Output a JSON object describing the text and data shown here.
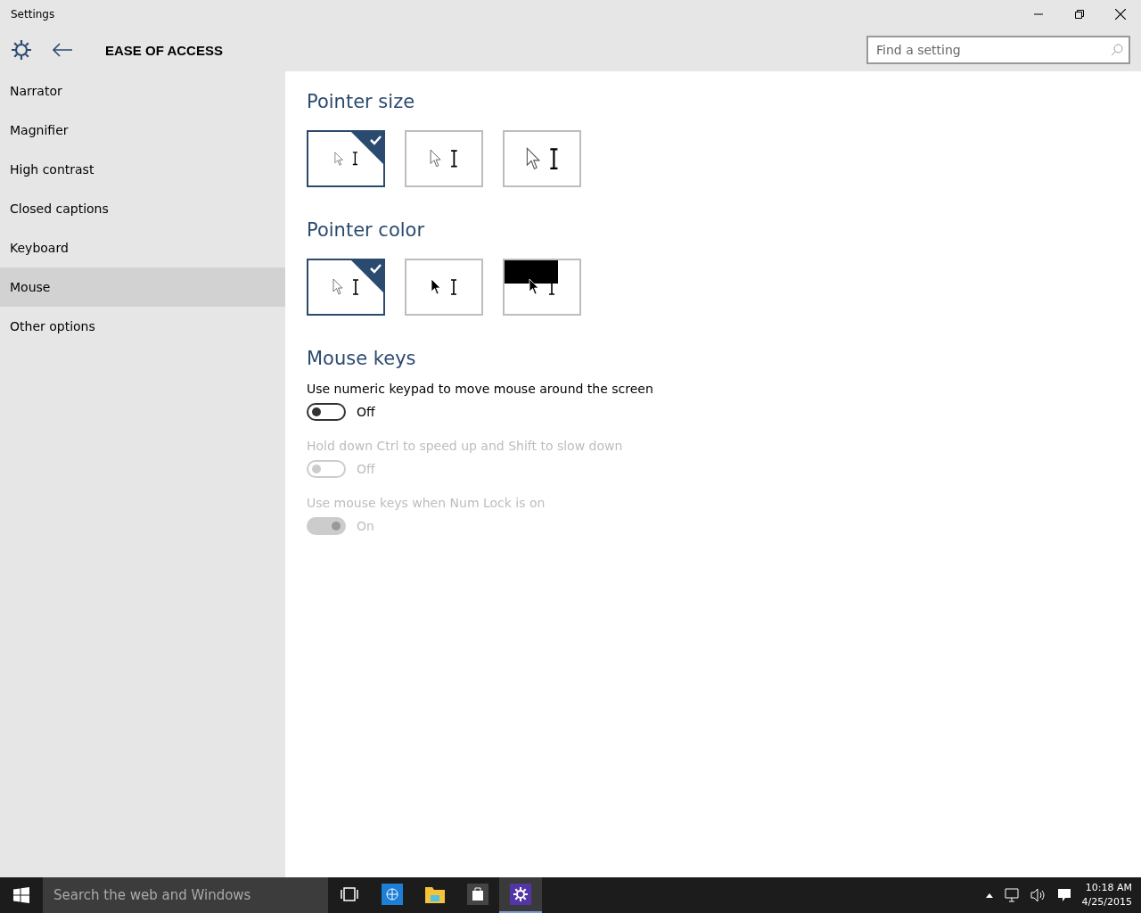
{
  "window": {
    "title": "Settings"
  },
  "header": {
    "title": "EASE OF ACCESS",
    "search": {
      "placeholder": "Find a setting"
    }
  },
  "sidebar": {
    "items": [
      {
        "label": "Narrator",
        "selected": false
      },
      {
        "label": "Magnifier",
        "selected": false
      },
      {
        "label": "High contrast",
        "selected": false
      },
      {
        "label": "Closed captions",
        "selected": false
      },
      {
        "label": "Keyboard",
        "selected": false
      },
      {
        "label": "Mouse",
        "selected": true
      },
      {
        "label": "Other options",
        "selected": false
      }
    ]
  },
  "pointer_size": {
    "title": "Pointer size",
    "options": [
      {
        "kind": "small",
        "selected": true
      },
      {
        "kind": "medium",
        "selected": false
      },
      {
        "kind": "large",
        "selected": false
      }
    ]
  },
  "pointer_color": {
    "title": "Pointer color",
    "options": [
      {
        "kind": "white",
        "selected": true
      },
      {
        "kind": "black",
        "selected": false
      },
      {
        "kind": "inverted",
        "selected": false
      }
    ]
  },
  "mouse_keys": {
    "title": "Mouse keys",
    "settings": [
      {
        "label": "Use numeric keypad to move mouse around the screen",
        "on": false,
        "disabled": false,
        "state": "Off"
      },
      {
        "label": "Hold down Ctrl to speed up and Shift to slow down",
        "on": false,
        "disabled": true,
        "state": "Off"
      },
      {
        "label": "Use mouse keys when Num Lock is on",
        "on": true,
        "disabled": true,
        "state": "On"
      }
    ]
  },
  "taskbar": {
    "search": {
      "placeholder": "Search the web and Windows"
    },
    "apps": [
      {
        "kind": "taskview",
        "selected": false
      },
      {
        "kind": "browser",
        "selected": false
      },
      {
        "kind": "explorer",
        "selected": false
      },
      {
        "kind": "store",
        "selected": false
      },
      {
        "kind": "settings",
        "selected": true
      }
    ],
    "time": "10:18 AM",
    "date": "4/25/2015"
  }
}
